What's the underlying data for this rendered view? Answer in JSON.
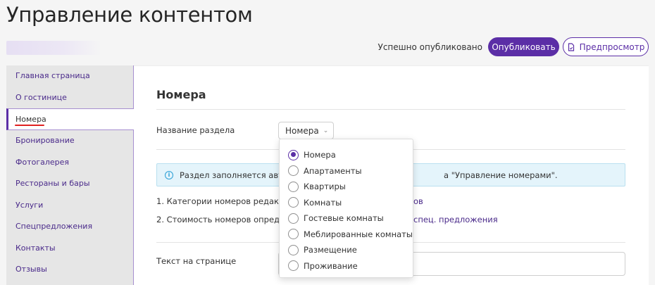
{
  "header": {
    "title": "Управление контентом",
    "status": "Успешно опубликовано",
    "publish_label": "Опубликовать",
    "preview_label": "Предпросмотр"
  },
  "sidebar": {
    "items": [
      {
        "label": "Главная страница"
      },
      {
        "label": "О гостинице"
      },
      {
        "label": "Номера",
        "active": true
      },
      {
        "label": "Бронирование"
      },
      {
        "label": "Фотогалерея"
      },
      {
        "label": "Рестораны и бары"
      },
      {
        "label": "Услуги"
      },
      {
        "label": "Спецпредложения"
      },
      {
        "label": "Контакты"
      },
      {
        "label": "Отзывы"
      }
    ]
  },
  "main": {
    "heading": "Номера",
    "section_name_label": "Название раздела",
    "section_name_value": "Номера",
    "info_text_start": "Раздел заполняется автом",
    "info_text_end": "а \"Управление номерами\".",
    "line1_start": "1. Категории номеров редактир",
    "line1_link": "ов",
    "line2_start": "2. Стоимость номеров определя",
    "line2_link": "спец. предложения",
    "page_text_label": "Текст на странице"
  },
  "dropdown": {
    "selected": "Номера",
    "options": [
      "Номера",
      "Апартаменты",
      "Квартиры",
      "Комнаты",
      "Гостевые комнаты",
      "Меблированные комнаты",
      "Размещение",
      "Проживание"
    ]
  },
  "colors": {
    "accent": "#5b2ea6",
    "link": "#4a2a8a",
    "info_bg": "#e4f4fb",
    "info_icon": "#2a9fd6",
    "active_underline": "#e02020"
  }
}
